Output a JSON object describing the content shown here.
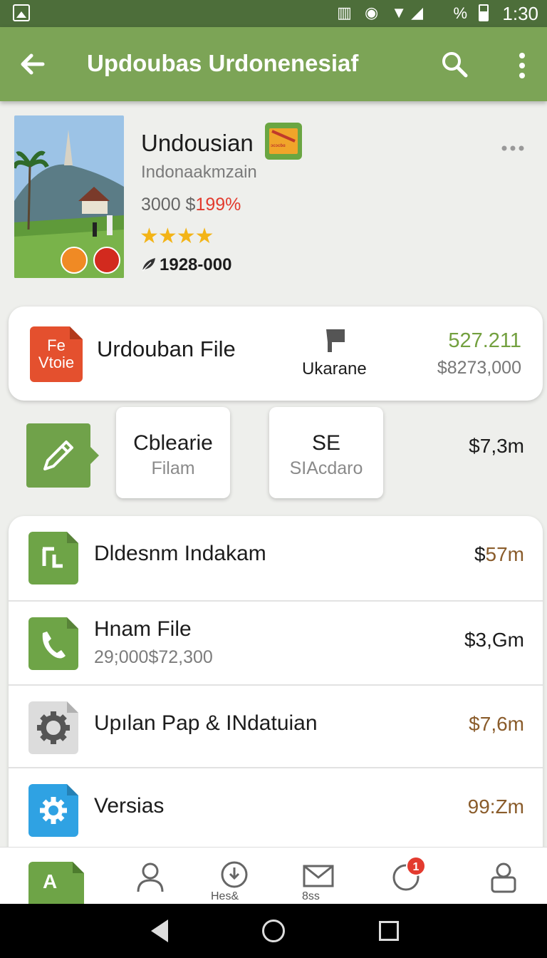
{
  "status_bar": {
    "percent": "%",
    "time": "1:30"
  },
  "app_bar": {
    "title": "Updoubas Urdonenesiaf"
  },
  "header": {
    "app_name": "Undousian",
    "badge_text": "ɔcɔcɓɑ",
    "subtitle": "Indonaakmzain",
    "price_prefix": "3000 $",
    "price_highlight": "199%",
    "stars": "★★★★",
    "downloads": "1928-000"
  },
  "file_card": {
    "icon_text_1": "Fe",
    "icon_text_2": "Vtoie",
    "title": "Urdouban File",
    "mid_label": "Ukarane",
    "value_green": "527.211",
    "value_gray": "$8273,000"
  },
  "actions": {
    "chip1_title": "Cblearie",
    "chip1_sub": "Filam",
    "chip2_title": "SE",
    "chip2_sub": "SIAcdaro",
    "value": "$7,3m"
  },
  "list": [
    {
      "label": "Dldesnm Indakam",
      "amount_prefix": "$",
      "amount": "57m",
      "icon": "document-icon"
    },
    {
      "label": "Hnam File",
      "sub": "29;000$72,300",
      "amount": "$3,Gm",
      "icon": "phone-icon"
    },
    {
      "label": "Upılan Pap & INdatuian",
      "amount": "$7,6m",
      "icon": "settings-icon"
    },
    {
      "label": "Versias",
      "amount": "99:Zm",
      "icon": "gear-icon"
    }
  ],
  "bottom_nav": {
    "doc_letter": "A",
    "label_3": "Hes&",
    "label_4": "8ss",
    "badge": "1"
  },
  "colors": {
    "primary": "#7ca456",
    "status_bar": "#4d6e3a",
    "accent_red": "#e23b2e",
    "value_green": "#73a03f"
  }
}
